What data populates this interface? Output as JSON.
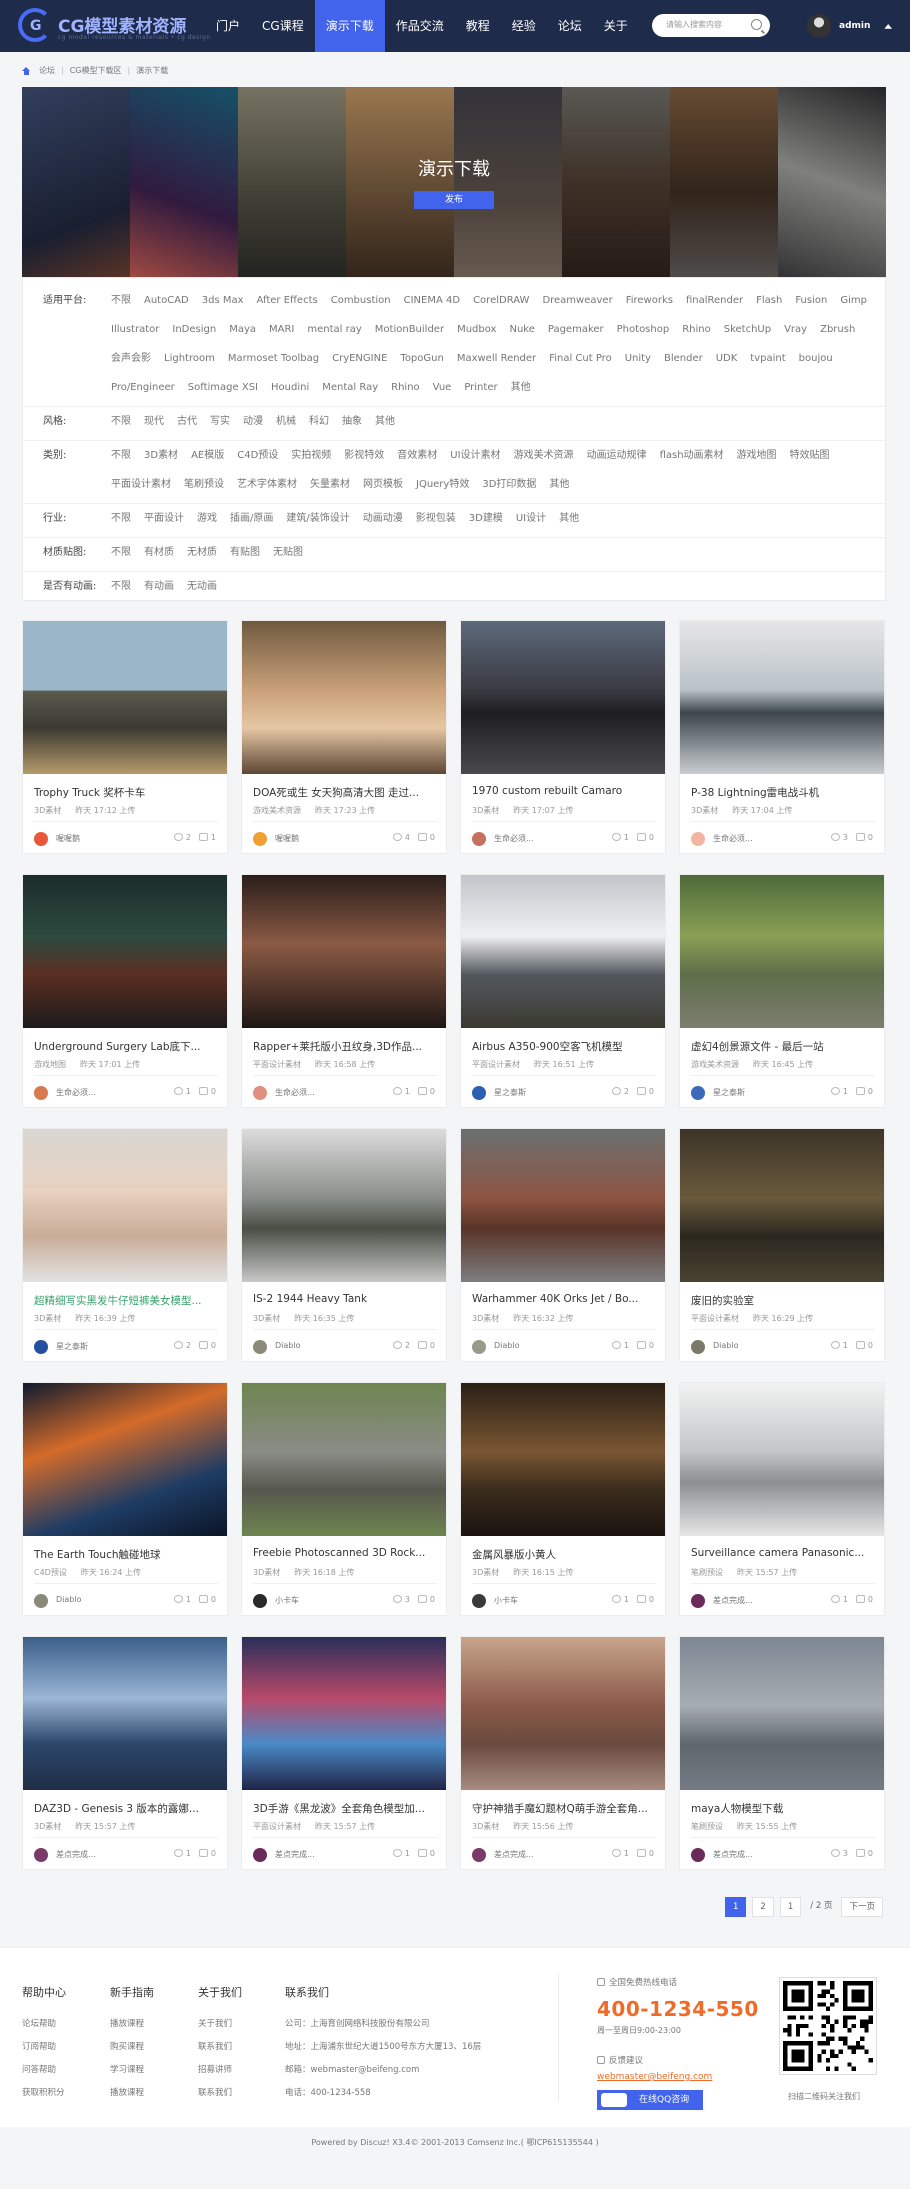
{
  "header": {
    "logo_text": "CG模型素材资源",
    "logo_sub": "cg model resources & materials • cg design",
    "nav": [
      "门户",
      "CG课程",
      "演示下载",
      "作品交流",
      "教程",
      "经验",
      "论坛",
      "关于"
    ],
    "active_nav": "演示下载",
    "search_placeholder": "请输入搜索内容",
    "username": "admin"
  },
  "breadcrumb": [
    "论坛",
    "CG模型下载区",
    "演示下载"
  ],
  "banner": {
    "title": "演示下载",
    "publish": "发布"
  },
  "filters": [
    {
      "label": "适用平台:",
      "options": [
        "不限",
        "AutoCAD",
        "3ds Max",
        "After Effects",
        "Combustion",
        "CINEMA 4D",
        "CorelDRAW",
        "Dreamweaver",
        "Fireworks",
        "finalRender",
        "Flash",
        "Fusion",
        "Gimp",
        "Illustrator",
        "InDesign",
        "Maya",
        "MARI",
        "mental ray",
        "MotionBuilder",
        "Mudbox",
        "Nuke",
        "Pagemaker",
        "Photoshop",
        "Rhino",
        "SketchUp",
        "Vray",
        "Zbrush",
        "会声会影",
        "Lightroom",
        "Marmoset Toolbag",
        "CryENGINE",
        "TopoGun",
        "Maxwell Render",
        "Final Cut Pro",
        "Unity",
        "Blender",
        "UDK",
        "tvpaint",
        "boujou",
        "Pro/Engineer",
        "Softimage XSI",
        "Houdini",
        "Mental Ray",
        "Rhino",
        "Vue",
        "Printer",
        "其他"
      ]
    },
    {
      "label": "风格:",
      "options": [
        "不限",
        "现代",
        "古代",
        "写实",
        "动漫",
        "机械",
        "科幻",
        "抽象",
        "其他"
      ]
    },
    {
      "label": "类别:",
      "options": [
        "不限",
        "3D素材",
        "AE模版",
        "C4D预设",
        "实拍视频",
        "影视特效",
        "音效素材",
        "UI设计素材",
        "游戏美术资源",
        "动画运动规律",
        "flash动画素材",
        "游戏地图",
        "特效贴图",
        "平面设计素材",
        "笔刷预设",
        "艺术字体素材",
        "矢量素材",
        "网页模板",
        "JQuery特效",
        "3D打印数据",
        "其他"
      ]
    },
    {
      "label": "行业:",
      "options": [
        "不限",
        "平面设计",
        "游戏",
        "插画/原画",
        "建筑/装饰设计",
        "动画动漫",
        "影视包装",
        "3D建模",
        "UI设计",
        "其他"
      ]
    },
    {
      "label": "材质贴图:",
      "options": [
        "不限",
        "有材质",
        "无材质",
        "有贴图",
        "无贴图"
      ]
    },
    {
      "label": "是否有动画:",
      "options": [
        "不限",
        "有动画",
        "无动画"
      ]
    }
  ],
  "cards": [
    {
      "title": "Trophy Truck 奖杯卡车",
      "cat": "3D素材",
      "time": "昨天 17:12 上传",
      "author": "喔喔鹅",
      "views": "2",
      "comments": "1",
      "green": false
    },
    {
      "title": "DOA死或生 女天狗高清大图 走过...",
      "cat": "游戏美术资源",
      "time": "昨天 17:23 上传",
      "author": "喔喔鹅",
      "views": "4",
      "comments": "0",
      "green": false
    },
    {
      "title": "1970 custom rebuilt Camaro",
      "cat": "3D素材",
      "time": "昨天 17:07 上传",
      "author": "生命必须...",
      "views": "1",
      "comments": "0",
      "green": false
    },
    {
      "title": "P-38 Lightning雷电战斗机",
      "cat": "3D素材",
      "time": "昨天 17:04 上传",
      "author": "生命必须...",
      "views": "3",
      "comments": "0",
      "green": false
    },
    {
      "title": "Underground Surgery Lab底下...",
      "cat": "游戏地图",
      "time": "昨天 17:01 上传",
      "author": "生命必须...",
      "views": "1",
      "comments": "0",
      "green": false
    },
    {
      "title": "Rapper+莱托版小丑纹身,3D作品...",
      "cat": "平面设计素材",
      "time": "昨天 16:58 上传",
      "author": "生命必须...",
      "views": "1",
      "comments": "0",
      "green": false
    },
    {
      "title": "Airbus A350-900空客飞机模型",
      "cat": "平面设计素材",
      "time": "昨天 16:51 上传",
      "author": "星之泰斯",
      "views": "2",
      "comments": "0",
      "green": false
    },
    {
      "title": "虚幻4创景源文件 - 最后一站",
      "cat": "游戏美术资源",
      "time": "昨天 16:45 上传",
      "author": "星之泰斯",
      "views": "1",
      "comments": "0",
      "green": false
    },
    {
      "title": "超精细写实黑发牛仔短裤美女模型...",
      "cat": "3D素材",
      "time": "昨天 16:39 上传",
      "author": "星之泰斯",
      "views": "2",
      "comments": "0",
      "green": true
    },
    {
      "title": "IS-2 1944 Heavy Tank",
      "cat": "3D素材",
      "time": "昨天 16:35 上传",
      "author": "Diablo",
      "views": "2",
      "comments": "0",
      "green": false
    },
    {
      "title": "Warhammer 40K Orks Jet / Bo...",
      "cat": "3D素材",
      "time": "昨天 16:32 上传",
      "author": "Diablo",
      "views": "1",
      "comments": "0",
      "green": false
    },
    {
      "title": "废旧的实验室",
      "cat": "平面设计素材",
      "time": "昨天 16:29 上传",
      "author": "Diablo",
      "views": "1",
      "comments": "0",
      "green": false
    },
    {
      "title": "The Earth Touch触碰地球",
      "cat": "C4D预设",
      "time": "昨天 16:24 上传",
      "author": "Diablo",
      "views": "1",
      "comments": "0",
      "green": false
    },
    {
      "title": "Freebie Photoscanned 3D Rock...",
      "cat": "3D素材",
      "time": "昨天 16:18 上传",
      "author": "小卡车",
      "views": "3",
      "comments": "0",
      "green": false
    },
    {
      "title": "金属风暴版小黄人",
      "cat": "3D素材",
      "time": "昨天 16:15 上传",
      "author": "小卡车",
      "views": "1",
      "comments": "0",
      "green": false
    },
    {
      "title": "Surveillance camera Panasonic...",
      "cat": "笔刷预设",
      "time": "昨天 15:57 上传",
      "author": "差点完成...",
      "views": "1",
      "comments": "0",
      "green": false
    },
    {
      "title": "DAZ3D - Genesis 3 版本的露娜...",
      "cat": "3D素材",
      "time": "昨天 15:57 上传",
      "author": "差点完成...",
      "views": "1",
      "comments": "0",
      "green": false
    },
    {
      "title": "3D手游《黑龙波》全套角色模型加...",
      "cat": "平面设计素材",
      "time": "昨天 15:57 上传",
      "author": "差点完成...",
      "views": "1",
      "comments": "0",
      "green": false
    },
    {
      "title": "守护神猎手魔幻题材Q萌手游全套角...",
      "cat": "3D素材",
      "time": "昨天 15:56 上传",
      "author": "差点完成...",
      "views": "1",
      "comments": "0",
      "green": false
    },
    {
      "title": "maya人物模型下载",
      "cat": "笔刷预设",
      "time": "昨天 15:55 上传",
      "author": "差点完成...",
      "views": "3",
      "comments": "0",
      "green": false
    }
  ],
  "pager": {
    "pages": [
      "1",
      "2"
    ],
    "input": "1",
    "total": "/ 2 页",
    "next": "下一页"
  },
  "footer": {
    "cols": [
      {
        "title": "帮助中心",
        "links": [
          "论坛帮助",
          "订阅帮助",
          "问答帮助",
          "获取积积分"
        ]
      },
      {
        "title": "新手指南",
        "links": [
          "播放课程",
          "购买课程",
          "学习课程",
          "播放课程"
        ]
      },
      {
        "title": "关于我们",
        "links": [
          "关于我们",
          "联系我们",
          "招募讲师",
          "联系我们"
        ]
      },
      {
        "title": "联系我们",
        "links": [
          "公司：上海育创网络科技股份有限公司",
          "地址：上海浦东世纪大道1500号东方大厦13、16层",
          "邮箱：webmaster@beifeng.com",
          "电话：400-1234-558"
        ]
      }
    ],
    "hotline_label": "全国免费热线电话",
    "hotline": "400-1234-550",
    "hours": "周一至周日9:00-23:00",
    "feedback_label": "反馈建议",
    "feedback_email": "webmaster@beifeng.com",
    "qq_button": "在线QQ咨询",
    "qr_caption": "扫描二维码关注我们",
    "copyright": "Powered by Discuz! X3.4© 2001-2013 Comsenz Inc.( 鄂ICP615135544 )"
  },
  "colors": {
    "header": "#1f2b4a",
    "accent": "#4263eb",
    "hotline": "#f06a28"
  }
}
